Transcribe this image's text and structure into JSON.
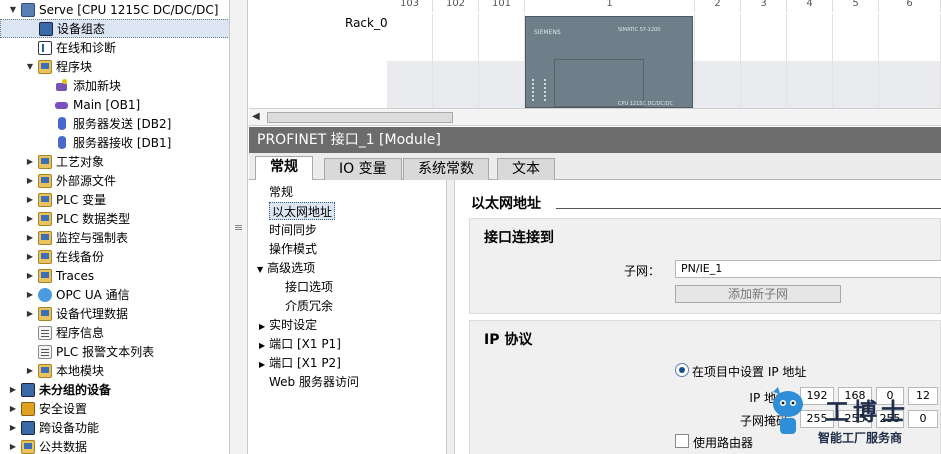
{
  "tree": {
    "items": [
      {
        "label": "Serve [CPU 1215C DC/DC/DC]",
        "icon": "cpu-icon",
        "expand": "▼",
        "indent": 0
      },
      {
        "label": "设备组态",
        "icon": "device-config-icon",
        "expand": "",
        "indent": 1,
        "selected": true
      },
      {
        "label": "在线和诊断",
        "icon": "diagnostics-icon",
        "expand": "",
        "indent": 1
      },
      {
        "label": "程序块",
        "icon": "folder-icon",
        "expand": "▼",
        "indent": 1
      },
      {
        "label": "添加新块",
        "icon": "add-block-icon",
        "expand": "",
        "indent": 2
      },
      {
        "label": "Main [OB1]",
        "icon": "ob-block-icon",
        "expand": "",
        "indent": 2
      },
      {
        "label": "服务器发送 [DB2]",
        "icon": "db-block-icon",
        "expand": "",
        "indent": 2
      },
      {
        "label": "服务器接收 [DB1]",
        "icon": "db-block-icon",
        "expand": "",
        "indent": 2
      },
      {
        "label": "工艺对象",
        "icon": "folder-icon",
        "expand": "▶",
        "indent": 1
      },
      {
        "label": "外部源文件",
        "icon": "folder-icon",
        "expand": "▶",
        "indent": 1
      },
      {
        "label": "PLC 变量",
        "icon": "folder-icon",
        "expand": "▶",
        "indent": 1
      },
      {
        "label": "PLC 数据类型",
        "icon": "folder-icon",
        "expand": "▶",
        "indent": 1
      },
      {
        "label": "监控与强制表",
        "icon": "folder-icon",
        "expand": "▶",
        "indent": 1
      },
      {
        "label": "在线备份",
        "icon": "folder-icon",
        "expand": "▶",
        "indent": 1
      },
      {
        "label": "Traces",
        "icon": "folder-icon",
        "expand": "▶",
        "indent": 1
      },
      {
        "label": "OPC UA 通信",
        "icon": "globe-icon",
        "expand": "▶",
        "indent": 1
      },
      {
        "label": "设备代理数据",
        "icon": "folder-icon",
        "expand": "▶",
        "indent": 1
      },
      {
        "label": "程序信息",
        "icon": "sheet-icon",
        "expand": "",
        "indent": 1
      },
      {
        "label": "PLC 报警文本列表",
        "icon": "sheet-icon",
        "expand": "",
        "indent": 1
      },
      {
        "label": "本地模块",
        "icon": "folder-icon",
        "expand": "▶",
        "indent": 1
      },
      {
        "label": "未分组的设备",
        "icon": "device-icon",
        "expand": "▶",
        "indent": 0,
        "bold": true
      },
      {
        "label": "安全设置",
        "icon": "shield-icon",
        "expand": "▶",
        "indent": 0
      },
      {
        "label": "跨设备功能",
        "icon": "device-icon",
        "expand": "▶",
        "indent": 0
      },
      {
        "label": "公共数据",
        "icon": "folder-icon",
        "expand": "▶",
        "indent": 0
      }
    ]
  },
  "rack": {
    "label": "Rack_0",
    "slots": [
      "103",
      "102",
      "101",
      "1",
      "2",
      "3",
      "4",
      "5",
      "6"
    ],
    "plc_logo": "SIEMENS",
    "plc_model": "SIMATIC S7-1200",
    "plc_type": "CPU 1215C DC/DC/DC"
  },
  "properties": {
    "title": "PROFINET 接口_1 [Module]",
    "tabs": [
      "常规",
      "IO 变量",
      "系统常数",
      "文本"
    ],
    "active_tab": 0
  },
  "nav": {
    "items": [
      {
        "label": "常规",
        "indent": 0,
        "expand": ""
      },
      {
        "label": "以太网地址",
        "indent": 0,
        "expand": "",
        "selected": true
      },
      {
        "label": "时间同步",
        "indent": 0,
        "expand": ""
      },
      {
        "label": "操作模式",
        "indent": 0,
        "expand": ""
      },
      {
        "label": "高级选项",
        "indent": 0,
        "expand": "▼"
      },
      {
        "label": "接口选项",
        "indent": 2,
        "expand": ""
      },
      {
        "label": "介质冗余",
        "indent": 2,
        "expand": ""
      },
      {
        "label": "实时设定",
        "indent": 1,
        "expand": "▶"
      },
      {
        "label": "端口 [X1 P1]",
        "indent": 1,
        "expand": "▶"
      },
      {
        "label": "端口 [X1 P2]",
        "indent": 1,
        "expand": "▶"
      },
      {
        "label": "Web 服务器访问",
        "indent": 0,
        "expand": ""
      }
    ]
  },
  "ethernet": {
    "section_title": "以太网地址",
    "interface_title": "接口连接到",
    "subnet_label": "子网：",
    "subnet_value": "PN/IE_1",
    "add_subnet_button": "添加新子网",
    "ip_title": "IP 协议",
    "set_ip_radio": "在项目中设置 IP 地址",
    "ip_label": "IP 地址",
    "ip": [
      "192",
      "168",
      "0",
      "12"
    ],
    "mask_label": "子网掩码",
    "mask": [
      "255",
      "255",
      "255",
      "0"
    ],
    "router_label": "使用路由器"
  },
  "watermark": {
    "title": "工博士",
    "subtitle": "智能工厂服务商"
  },
  "colors": {
    "title_bar": "#6c6c6c",
    "selection": "#dbe6f2",
    "plc_body": "#6e7f8a"
  }
}
